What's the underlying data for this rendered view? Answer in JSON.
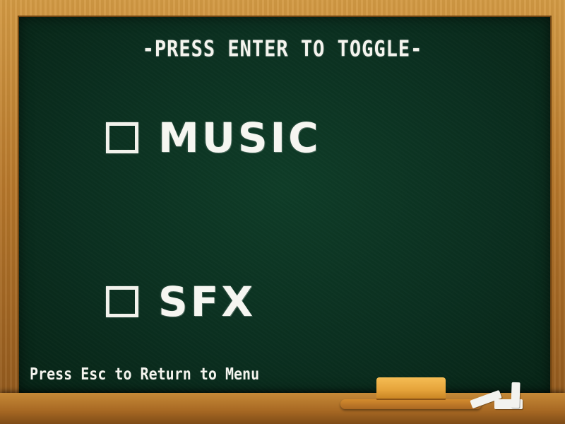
{
  "screen": {
    "title": "-PRESS ENTER TO TOGGLE-",
    "hint": "Press Esc to Return to Menu"
  },
  "options": [
    {
      "label": "MUSIC",
      "checked": false
    },
    {
      "label": "SFX",
      "checked": false
    }
  ],
  "colors": {
    "board": "#0b3020",
    "frame": "#b6772b",
    "chalk": "#f4f4ee",
    "eraser": "#e5a33a"
  }
}
